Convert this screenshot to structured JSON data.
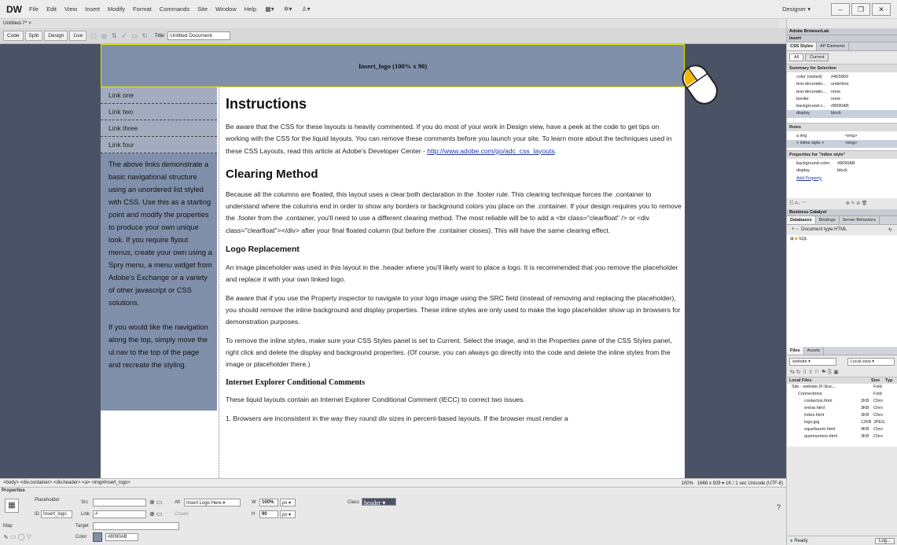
{
  "app": {
    "logo": "DW",
    "menu": [
      "File",
      "Edit",
      "View",
      "Insert",
      "Modify",
      "Format",
      "Commands",
      "Site",
      "Window",
      "Help"
    ],
    "workspace": "Designer",
    "doc_tab": "Untitled-7* ×"
  },
  "toolbar": {
    "buttons": [
      "Code",
      "Split",
      "Design",
      "Live"
    ],
    "title_label": "Title:",
    "title_value": "Untitled Document"
  },
  "page": {
    "header_label": "Insert_logo (100% x 90)",
    "nav": [
      "Link one",
      "Link two",
      "Link three",
      "Link four"
    ],
    "sidebar_p1": "The above links demonstrate a basic navigational structure using an unordered list styled with CSS. Use this as a starting point and modify the properties to produce your own unique look. If you require flyout menus, create your own using a Spry menu, a menu widget from Adobe's Exchange or a variety of other javascript or CSS solutions.",
    "sidebar_p2": "If you would like the navigation along the top, simply move the ul.nav to the top of the page and recreate the styling.",
    "h1": "Instructions",
    "p1a": "Be aware that the CSS for these layouts is heavily commented. If you do most of your work in Design view, have a peek at the code to get tips on working with the CSS for the liquid layouts. You can remove these comments before you launch your site. To learn more about the techniques used in these CSS Layouts, read this article at Adobe's Developer Center - ",
    "p1_link": "http://www.adobe.com/go/adc_css_layouts",
    "p1b": ".",
    "h2": "Clearing Method",
    "p2": "Because all the columns are floated, this layout uses a clear:both declaration in the .footer rule. This clearing technique forces the .container to understand where the columns end in order to show any borders or background colors you place on the .container. If your design requires you to remove the .footer from the .container, you'll need to use a different clearing method. The most reliable will be to add a <br class=\"clearfloat\" /> or <div class=\"clearfloat\"></div> after your final floated column (but before the .container closes). This will have the same clearing effect.",
    "h3": "Logo Replacement",
    "p3": "An image placeholder was used in this layout in the .header where you'll likely want to place a logo. It is recommended that you remove the placeholder and replace it with your own linked logo.",
    "p4": "Be aware that if you use the Property inspector to navigate to your logo image using the SRC field (instead of removing and replacing the placeholder), you should remove the inline background and display properties. These inline styles are only used to make the logo placeholder show up in browsers for demonstration purposes.",
    "p5": "To remove the inline styles, make sure your CSS Styles panel is set to Current. Select the image, and in the Properties pane of the CSS Styles panel, right click and delete the display and background properties. (Of course, you can always go directly into the code and delete the inline styles from the image or placeholder there.)",
    "h4": "Internet Explorer Conditional Comments",
    "p6": "These liquid layouts contain an Internet Explorer Conditional Comment (IECC) to correct two issues.",
    "p7": "1.  Browsers are inconsistent in the way they round div sizes in percent-based layouts. If the browser must render a"
  },
  "status": {
    "tags": "<body> <div.container> <div.header> <a> <img#Insert_logo>",
    "zoom": "100%",
    "info": "1668 x 929 ▾ 1K / 1 sec  Unicode (UTF-8)"
  },
  "props": {
    "panel_title": "Properties",
    "type": "Placeholder",
    "id_label": "ID",
    "id_value": "Insert_logo",
    "src_label": "Src",
    "link_label": "Link",
    "link_value": "#",
    "alt_label": "Alt",
    "alt_value": "Insert Logo Here",
    "w_label": "W",
    "w_value": "100%",
    "w_unit": "px",
    "h_label": "H",
    "h_value": "90",
    "h_unit": "px",
    "class_label": "Class",
    "class_value": "header",
    "create_label": "Create",
    "map_label": "Map",
    "target_label": "Target",
    "color_label": "Color",
    "color_value": "#8090AB"
  },
  "right": {
    "browserlab": "Adobe BrowserLab",
    "insert": "Insert",
    "css_tabs": [
      "CSS Styles",
      "AP Elements"
    ],
    "mode_tabs": [
      "All",
      "Current"
    ],
    "summary_title": "Summary for Selection",
    "summary": [
      [
        "color (visited)",
        "#4E5869"
      ],
      [
        "text-decoratio...",
        "underline"
      ],
      [
        "text-decoratio...",
        "none"
      ],
      [
        "border",
        "none"
      ],
      [
        "background-c...",
        "#8090AB"
      ],
      [
        "display",
        "block"
      ]
    ],
    "rules_title": "Rules",
    "rules": [
      [
        "a img",
        "<img>"
      ],
      [
        "< inline style >",
        "<img>"
      ]
    ],
    "props_title": "Properties for \"inline style\"",
    "props": [
      [
        "background-color",
        "#8090AB"
      ],
      [
        "display",
        "block"
      ]
    ],
    "add_property": "Add Property",
    "bc_title": "Business Catalyst",
    "db_tabs": [
      "Databases",
      "Bindings",
      "Server Behaviors"
    ],
    "doctype": "Document type:HTML",
    "sql": "SQL",
    "files_tabs": [
      "Files",
      "Assets"
    ],
    "site": "website",
    "view": "Local view",
    "local_files": "Local Files",
    "size_col": "Size",
    "type_col": "Typ",
    "files": [
      [
        "Site - website (F:\\Esc...",
        "",
        "Fold"
      ],
      [
        "Connections",
        "",
        "Fold"
      ],
      [
        "contactos.html",
        "2KB",
        "Chro"
      ],
      [
        "entrar.html",
        "3KB",
        "Chro"
      ],
      [
        "index.html",
        "3KB",
        "Chro"
      ],
      [
        "logo.jpg",
        "12KB",
        "JPEG"
      ],
      [
        "oquefazem.html",
        "4KB",
        "Chro"
      ],
      [
        "quemsomos.html",
        "3KB",
        "Chro"
      ]
    ],
    "ready": "Ready",
    "log": "Log..."
  },
  "colors": {
    "accent": "#8090AB",
    "link": "#2233aa"
  }
}
